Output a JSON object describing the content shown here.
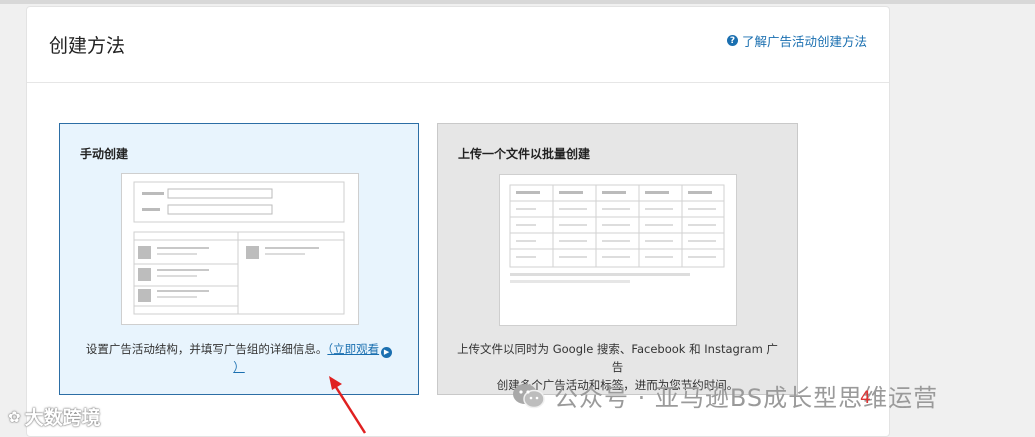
{
  "header": {
    "title": "创建方法",
    "help_link": "了解广告活动创建方法",
    "help_icon": "question-circle-icon"
  },
  "cards": {
    "manual": {
      "title": "手动创建",
      "description": "设置广告活动结构，并填写广告组的详细信息。",
      "watch_link": "（立即观看",
      "watch_close": "）",
      "play_icon": "play-circle-icon"
    },
    "bulk": {
      "title": "上传一个文件以批量创建",
      "description_line1": "上传文件以同时为 Google 搜索、Facebook 和 Instagram 广告",
      "description_line2": "创建多个广告活动和标签，进而为您节约时间。"
    }
  },
  "overlay": {
    "watermark_text": "公众号 · 亚马逊BS成长型思维运营",
    "annotation_number": "4",
    "logo_text": "大数跨境",
    "arrow_color": "#e02020"
  },
  "colors": {
    "accent": "#1a6fb0",
    "selected_card_bg": "#e8f4fd",
    "selected_card_border": "#2c6ea5",
    "unselected_card_bg": "#e6e6e6"
  }
}
